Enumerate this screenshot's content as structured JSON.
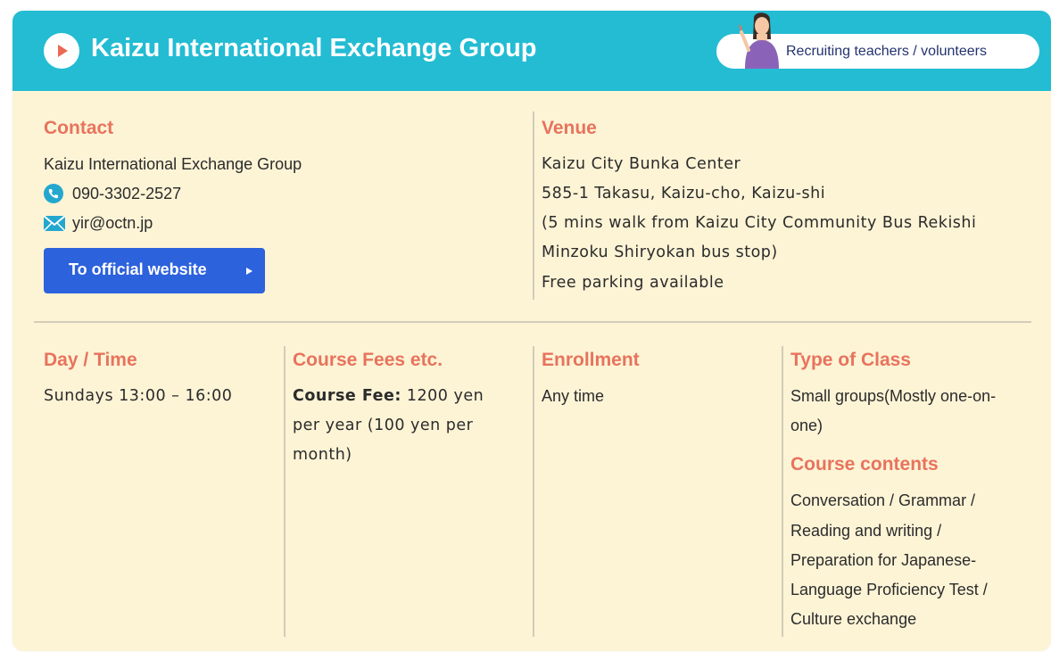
{
  "header": {
    "title": "Kaizu International Exchange Group",
    "recruit_label": "Recruiting teachers / volunteers"
  },
  "contact": {
    "heading": "Contact",
    "org": "Kaizu International Exchange Group",
    "phone": "090-3302-2527",
    "email": "yir@octn.jp",
    "button": "To official website"
  },
  "venue": {
    "heading": "Venue",
    "lines": [
      "Kaizu City Bunka Center",
      "585-1 Takasu, Kaizu-cho, Kaizu-shi",
      "(5 mins walk from Kaizu City Community Bus Rekishi",
      "Minzoku Shiryokan bus stop)",
      "Free parking available"
    ]
  },
  "day_time": {
    "heading": "Day / Time",
    "value": "Sundays 13:00 – 16:00"
  },
  "fees": {
    "heading": "Course Fees etc.",
    "fee_label": "Course Fee:",
    "lines": [
      " 1200 yen",
      "per year (100 yen per",
      "month)"
    ]
  },
  "enrollment": {
    "heading": "Enrollment",
    "value": "Any time"
  },
  "class_type": {
    "heading": "Type of Class",
    "lines": [
      "Small groups(Mostly one-on-",
      "one)"
    ]
  },
  "course_contents": {
    "heading": "Course contents",
    "lines": [
      "Conversation / Grammar /",
      "Reading and writing /",
      "Preparation for Japanese-",
      "Language Proficiency Test /",
      "Culture exchange"
    ]
  },
  "colors": {
    "header_bg": "#23bcd3",
    "card_bg": "#fdf4d6",
    "heading": "#e8735d",
    "button": "#2d62dd"
  },
  "icons": [
    "play-icon",
    "phone-icon",
    "mail-icon",
    "button-arrow-icon",
    "teacher-illustration"
  ]
}
